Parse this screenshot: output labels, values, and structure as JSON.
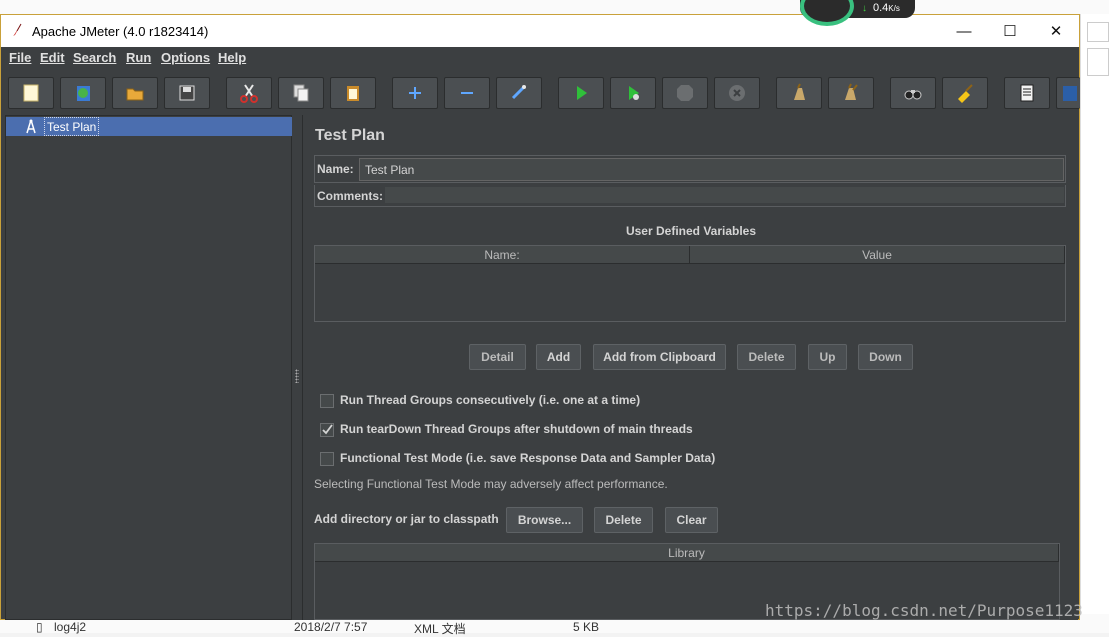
{
  "window": {
    "title": "Apache JMeter (4.0 r1823414)",
    "minimize": "—",
    "maximize": "☐",
    "close": "✕"
  },
  "net_widget": {
    "speed": "0.4",
    "unit": "K/s"
  },
  "menu": [
    "File",
    "Edit",
    "Search",
    "Run",
    "Options",
    "Help"
  ],
  "toolbar": [
    "new-icon",
    "templates-icon",
    "open-icon",
    "save-icon",
    "cut-icon",
    "copy-icon",
    "paste-icon",
    "expand-icon",
    "collapse-icon",
    "toggle-icon",
    "start-icon",
    "start-no-pause-icon",
    "stop-icon",
    "shutdown-icon",
    "clear-icon",
    "clear-all-icon",
    "search-icon",
    "reset-search-icon",
    "function-helper-icon",
    "help-icon"
  ],
  "tree": {
    "root_label": "Test Plan"
  },
  "panel": {
    "title": "Test Plan",
    "name_label": "Name:",
    "name_value": "Test Plan",
    "comments_label": "Comments:",
    "udv_title": "User Defined Variables",
    "udv_columns": [
      "Name:",
      "Value"
    ],
    "buttons": [
      "Detail",
      "Add",
      "Add from Clipboard",
      "Delete",
      "Up",
      "Down"
    ],
    "checkboxes": [
      {
        "label": "Run Thread Groups consecutively (i.e. one at a time)",
        "checked": false
      },
      {
        "label": "Run tearDown Thread Groups after shutdown of main threads",
        "checked": true
      },
      {
        "label": "Functional Test Mode (i.e. save Response Data and Sampler Data)",
        "checked": false
      }
    ],
    "functional_note": "Selecting Functional Test Mode may adversely affect performance.",
    "classpath_label": "Add directory or jar to classpath",
    "classpath_buttons": [
      "Browse...",
      "Delete",
      "Clear"
    ],
    "library_column": "Library"
  },
  "background_file": {
    "name": "log4j2",
    "date": "2018/2/7 7:57",
    "type": "XML 文档",
    "size": "5 KB"
  },
  "watermark": "https://blog.csdn.net/Purpose1123",
  "colors": {
    "window_bg": "#3c3f41",
    "selection": "#4b6eaf",
    "text": "#d4d4d4",
    "border_accent": "#c9a13a"
  }
}
